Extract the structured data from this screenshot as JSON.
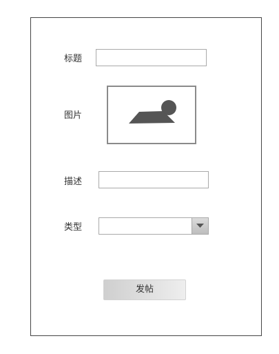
{
  "form": {
    "title_label": "标题",
    "title_value": "",
    "image_label": "图片",
    "image_icon": "image-placeholder-icon",
    "description_label": "描述",
    "description_value": "",
    "type_label": "类型",
    "type_selected": "",
    "dropdown_icon": "chevron-down-icon",
    "submit_label": "发帖"
  },
  "colors": {
    "border": "#444444",
    "input_border": "#a9a9a9",
    "icon_fill": "#555555",
    "button_gradient_start": "#cfcfcf",
    "button_gradient_end": "#eeeeee"
  }
}
